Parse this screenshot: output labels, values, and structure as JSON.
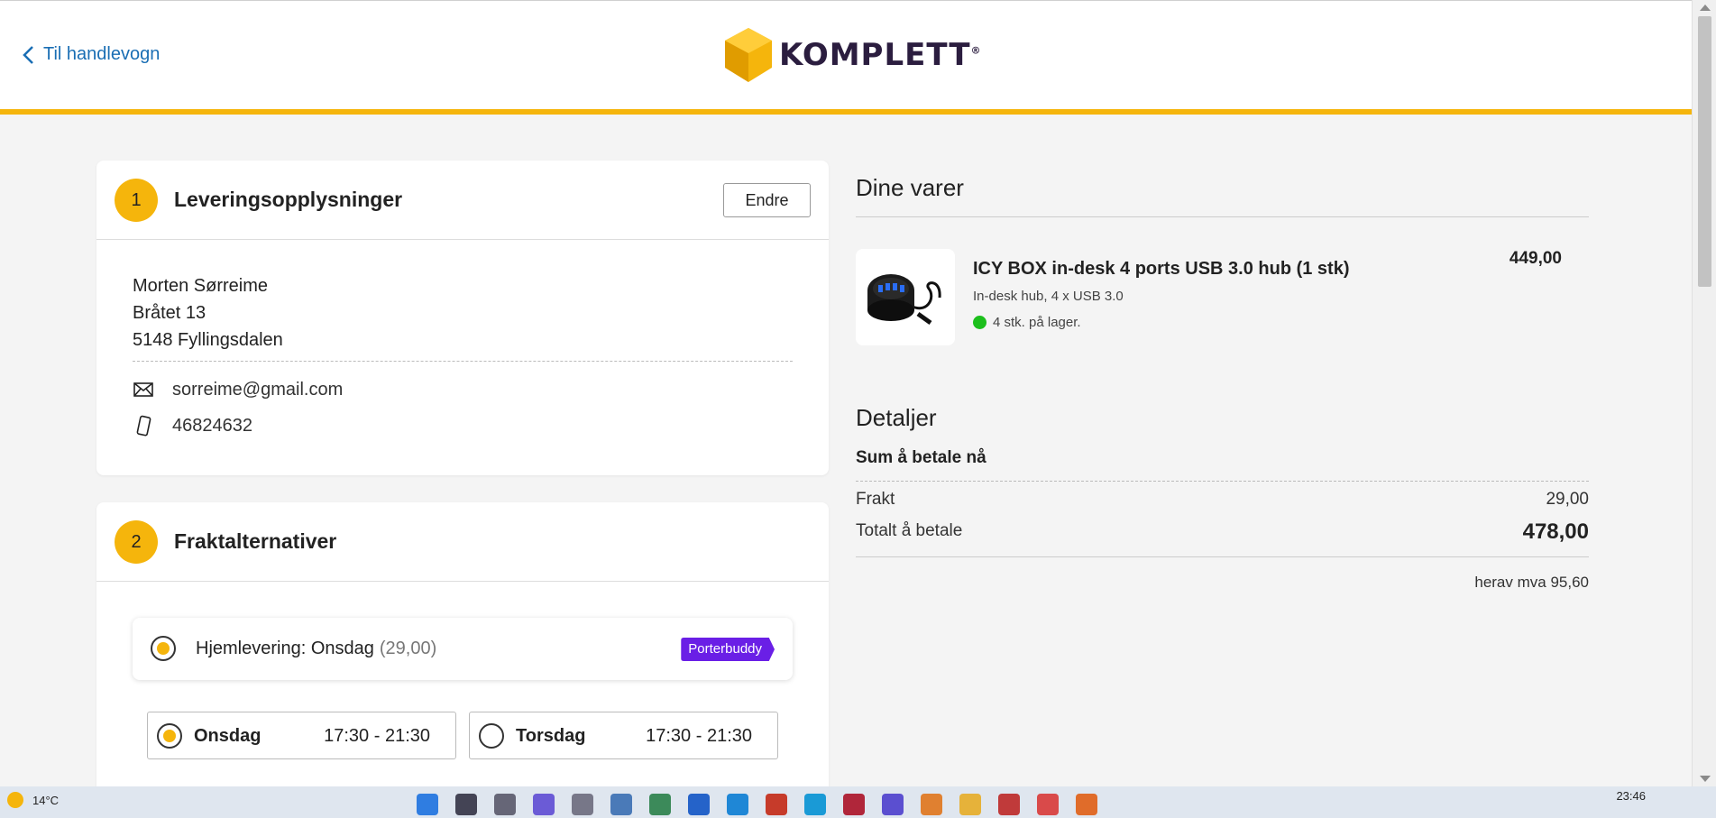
{
  "header": {
    "back_label": "Til handlevogn",
    "logo_text": "KOMPLETT",
    "logo_reg": "®"
  },
  "delivery_info": {
    "step": "1",
    "title": "Leveringsopplysninger",
    "edit_label": "Endre",
    "name": "Morten Sørreime",
    "street": "Bråtet 13",
    "postal": "5148 Fyllingsdalen",
    "email": "sorreime@gmail.com",
    "phone": "46824632"
  },
  "shipping": {
    "step": "2",
    "title": "Fraktalternativer",
    "option_label": "Hjemlevering: Onsdag",
    "option_price": "(29,00)",
    "option_selected": true,
    "provider_badge": "Porterbuddy",
    "days": [
      {
        "day": "Onsdag",
        "time": "17:30 - 21:30",
        "selected": true
      },
      {
        "day": "Torsdag",
        "time": "17:30 - 21:30",
        "selected": false
      }
    ]
  },
  "cart": {
    "title": "Dine varer",
    "item": {
      "name": "ICY BOX in-desk 4 ports USB 3.0 hub (1 stk)",
      "description": "In-desk hub, 4 x USB 3.0",
      "stock": "4 stk. på lager.",
      "price": "449,00"
    }
  },
  "details": {
    "title": "Detaljer",
    "sum_label": "Sum å betale nå",
    "shipping_label": "Frakt",
    "shipping_value": "29,00",
    "total_label": "Totalt å betale",
    "total_value": "478,00",
    "vat_text": "herav mva 95,60"
  },
  "taskbar": {
    "temperature": "14°C",
    "time": "23:46"
  },
  "colors": {
    "accent": "#f5b50c",
    "link": "#1a6eb4",
    "porterbuddy": "#6a1fe6",
    "in_stock": "#1cbf1c"
  },
  "icons": [
    "chevron-left-icon",
    "envelope-icon",
    "mobile-phone-icon",
    "in-stock-dot-icon"
  ]
}
